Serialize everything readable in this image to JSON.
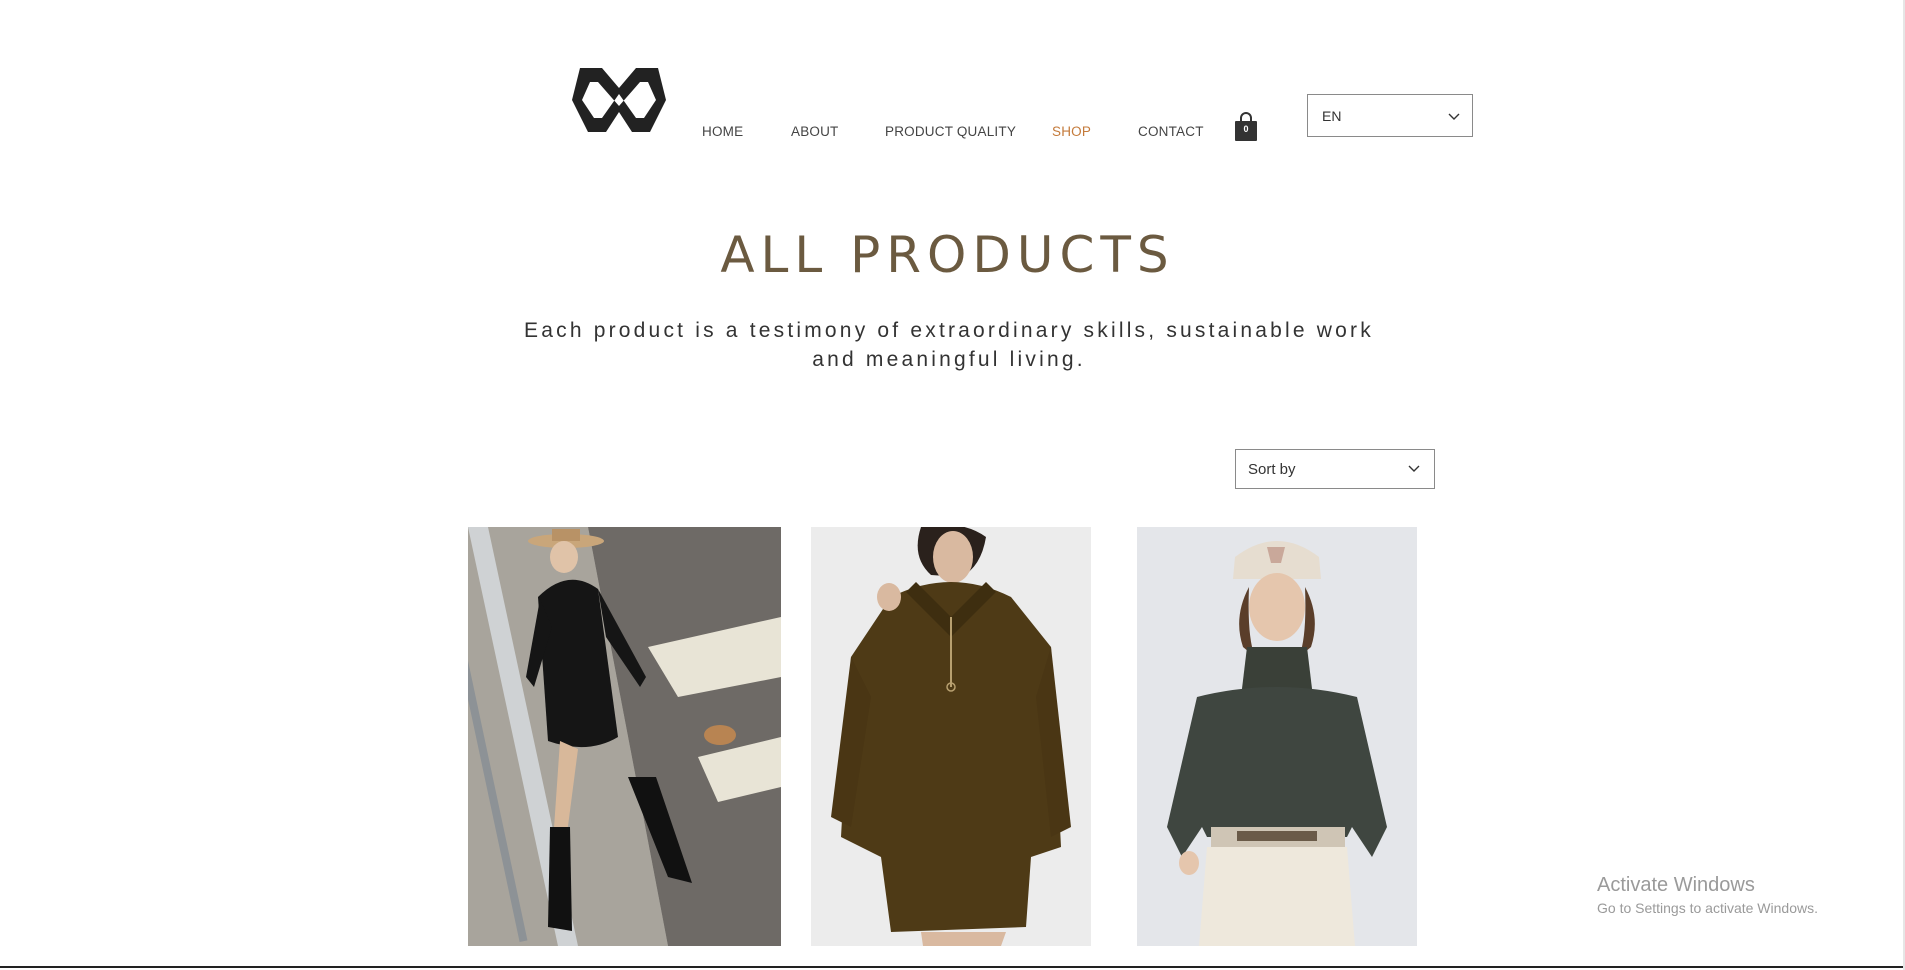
{
  "header": {
    "logo": "brand-logo",
    "nav": [
      {
        "label": "HOME",
        "active": false
      },
      {
        "label": "ABOUT",
        "active": false
      },
      {
        "label": "PRODUCT QUALITY",
        "active": false
      },
      {
        "label": "SHOP",
        "active": true
      },
      {
        "label": "CONTACT",
        "active": false
      }
    ],
    "cart_count": "0",
    "language": "EN"
  },
  "main": {
    "title": "ALL PRODUCTS",
    "subtitle": "Each product is a testimony of extraordinary skills, sustainable work and meaningful living.",
    "sort_label": "Sort by"
  },
  "products": [
    {
      "image": "woman in black wrap dress, hat and knee-high boots on street",
      "name": ""
    },
    {
      "image": "woman in brown zip-neck knit sweater dress",
      "name": ""
    },
    {
      "image": "woman in dark green turtleneck knit sweater and cap",
      "name": ""
    }
  ],
  "watermark": {
    "title": "Activate Windows",
    "subtitle": "Go to Settings to activate Windows."
  },
  "colors": {
    "accent": "#c47a3a",
    "title": "#6b5a40",
    "text": "#333333"
  }
}
